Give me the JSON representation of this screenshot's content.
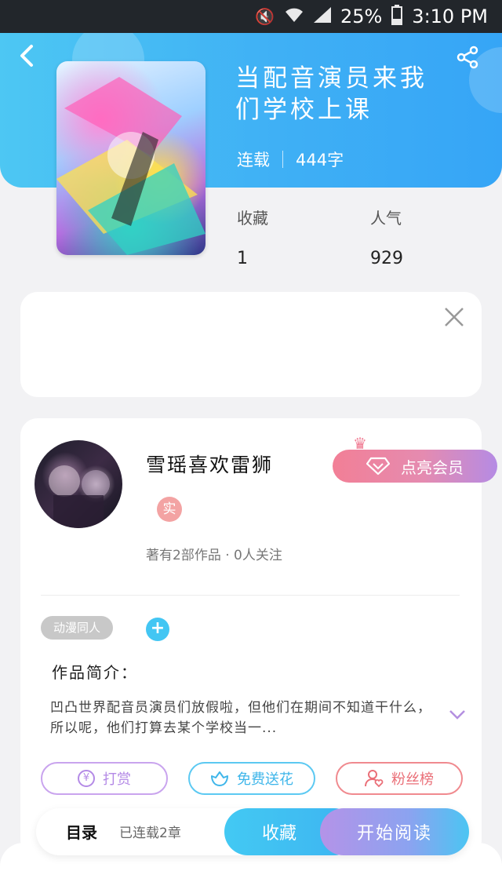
{
  "status_bar": {
    "battery": "25%",
    "time": "3:10 PM",
    "icons": [
      "mute-icon",
      "wifi-icon",
      "signal-icon",
      "battery-icon"
    ]
  },
  "book": {
    "title": "当配音演员来我们学校上课",
    "status": "连载",
    "word_count": "444字",
    "favorites_label": "收藏",
    "favorites_value": "1",
    "popularity_label": "人气",
    "popularity_value": "929"
  },
  "author": {
    "name": "雪瑶喜欢雷狮",
    "real_badge": "实",
    "info": "著有2部作品 · 0人关注",
    "vip_button": "点亮会员"
  },
  "tags": [
    "动漫同人"
  ],
  "intro": {
    "heading": "作品简介：",
    "text": "凹凸世界配音员演员们放假啦，但他们在期间不知道干什么，所以呢，他们打算去某个学校当一..."
  },
  "actions": {
    "reward": "打赏",
    "flower": "免费送花",
    "fans": "粉丝榜"
  },
  "bottom_bar": {
    "toc": "目录",
    "chapters": "已连载2章",
    "collect": "收藏",
    "read": "开始阅读"
  },
  "colors": {
    "header_start": "#4dc7f3",
    "header_end": "#36a5f6",
    "vip_pink": "#f27f96",
    "vip_purple": "#b58be4",
    "reward_purple": "#b48ae6",
    "flower_blue": "#3fb6ea",
    "fans_red": "#ea6f78"
  }
}
